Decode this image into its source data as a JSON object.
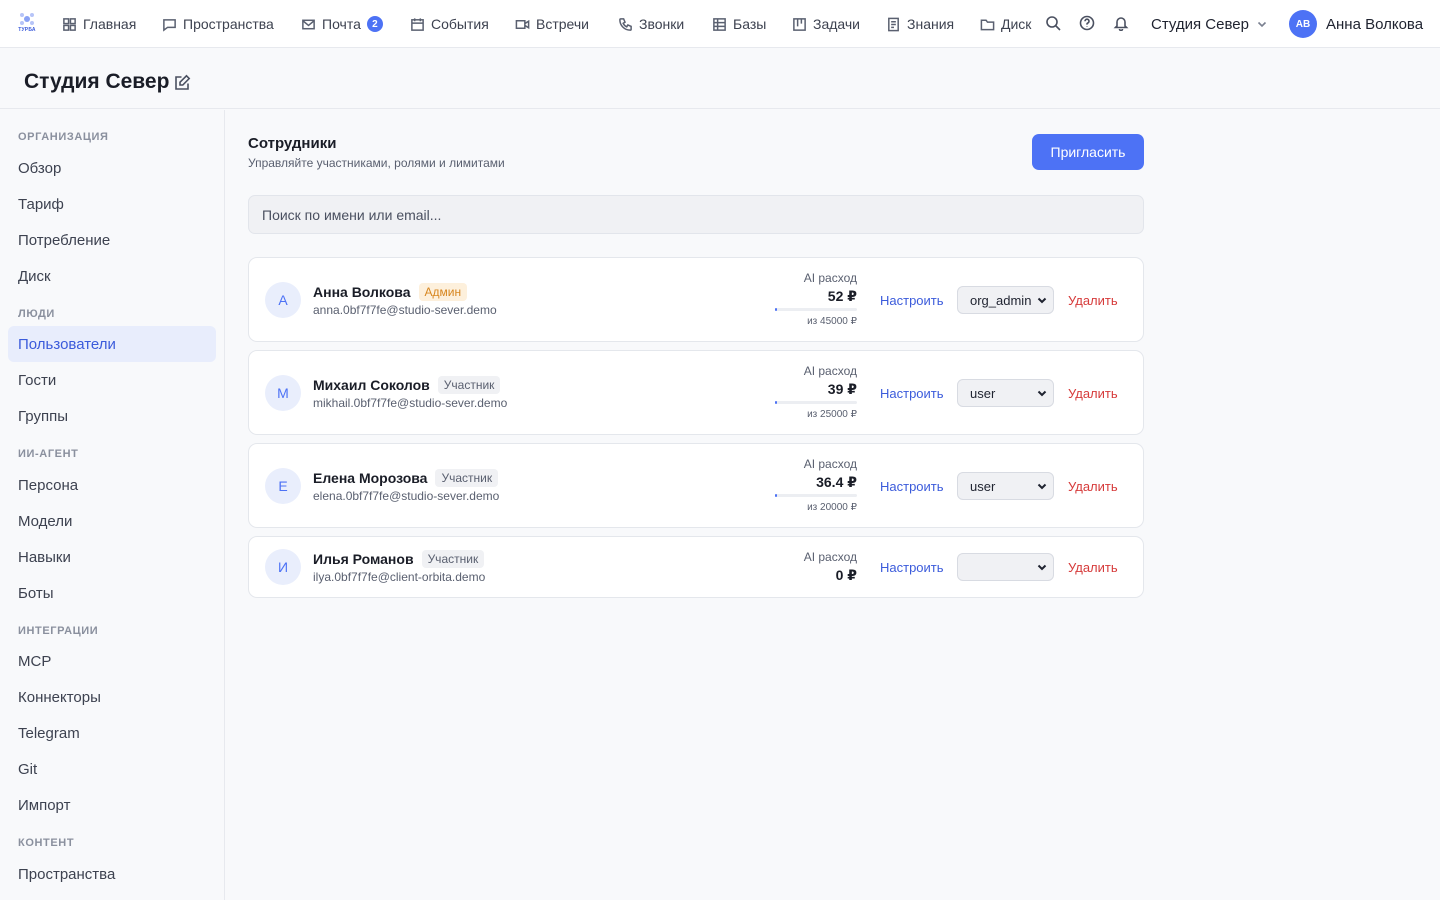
{
  "app": {
    "logo_text": "ТУРБА"
  },
  "nav": {
    "items": [
      {
        "label": "Главная",
        "icon": "home-icon"
      },
      {
        "label": "Пространства",
        "icon": "chat-icon"
      },
      {
        "label": "Почта",
        "icon": "mail-icon",
        "badge": "2"
      },
      {
        "label": "События",
        "icon": "calendar-icon"
      },
      {
        "label": "Встречи",
        "icon": "video-icon"
      },
      {
        "label": "Звонки",
        "icon": "phone-icon"
      },
      {
        "label": "Базы",
        "icon": "table-icon"
      },
      {
        "label": "Задачи",
        "icon": "kanban-icon"
      },
      {
        "label": "Знания",
        "icon": "document-icon"
      },
      {
        "label": "Диск",
        "icon": "folder-icon"
      }
    ],
    "org_name": "Студия Север",
    "user_initials": "АВ",
    "user_name": "Анна Волкова"
  },
  "page": {
    "title": "Студия Север"
  },
  "sidebar": {
    "sections": [
      {
        "title": "ОРГАНИЗАЦИЯ",
        "items": [
          "Обзор",
          "Тариф",
          "Потребление",
          "Диск"
        ]
      },
      {
        "title": "ЛЮДИ",
        "items": [
          "Пользователи",
          "Гости",
          "Группы"
        ]
      },
      {
        "title": "ИИ-АГЕНТ",
        "items": [
          "Персона",
          "Модели",
          "Навыки",
          "Боты"
        ]
      },
      {
        "title": "ИНТЕГРАЦИИ",
        "items": [
          "MCP",
          "Коннекторы",
          "Telegram",
          "Git",
          "Импорт"
        ]
      },
      {
        "title": "КОНТЕНТ",
        "items": [
          "Пространства"
        ]
      }
    ],
    "active_item": "Пользователи"
  },
  "main": {
    "title": "Сотрудники",
    "subtitle": "Управляйте участниками, ролями и лимитами",
    "invite_label": "Пригласить",
    "search_placeholder": "Поиск по имени или email...",
    "ai_label": "AI расход",
    "configure_label": "Настроить",
    "delete_label": "Удалить",
    "members": [
      {
        "initial": "А",
        "name": "Анна Волкова",
        "role_badge": "Админ",
        "email": "anna.0bf7f7fe@studio-sever.demo",
        "ai_spend": "52 ₽",
        "ai_limit": "из 45000 ₽",
        "usage_fraction": 0.0012,
        "role": "org_admin"
      },
      {
        "initial": "М",
        "name": "Михаил Соколов",
        "role_badge": "Участник",
        "email": "mikhail.0bf7f7fe@studio-sever.demo",
        "ai_spend": "39 ₽",
        "ai_limit": "из 25000 ₽",
        "usage_fraction": 0.0016,
        "role": "user"
      },
      {
        "initial": "Е",
        "name": "Елена Морозова",
        "role_badge": "Участник",
        "email": "elena.0bf7f7fe@studio-sever.demo",
        "ai_spend": "36.4 ₽",
        "ai_limit": "из 20000 ₽",
        "usage_fraction": 0.0018,
        "role": "user"
      },
      {
        "initial": "И",
        "name": "Илья Романов",
        "role_badge": "Участник",
        "email": "ilya.0bf7f7fe@client-orbita.demo",
        "ai_spend": "0 ₽",
        "ai_limit": "",
        "usage_fraction": 0,
        "role": ""
      }
    ]
  },
  "colors": {
    "accent": "#4d72f5",
    "danger": "#d63a3a",
    "admin_badge": "#d7861f"
  }
}
